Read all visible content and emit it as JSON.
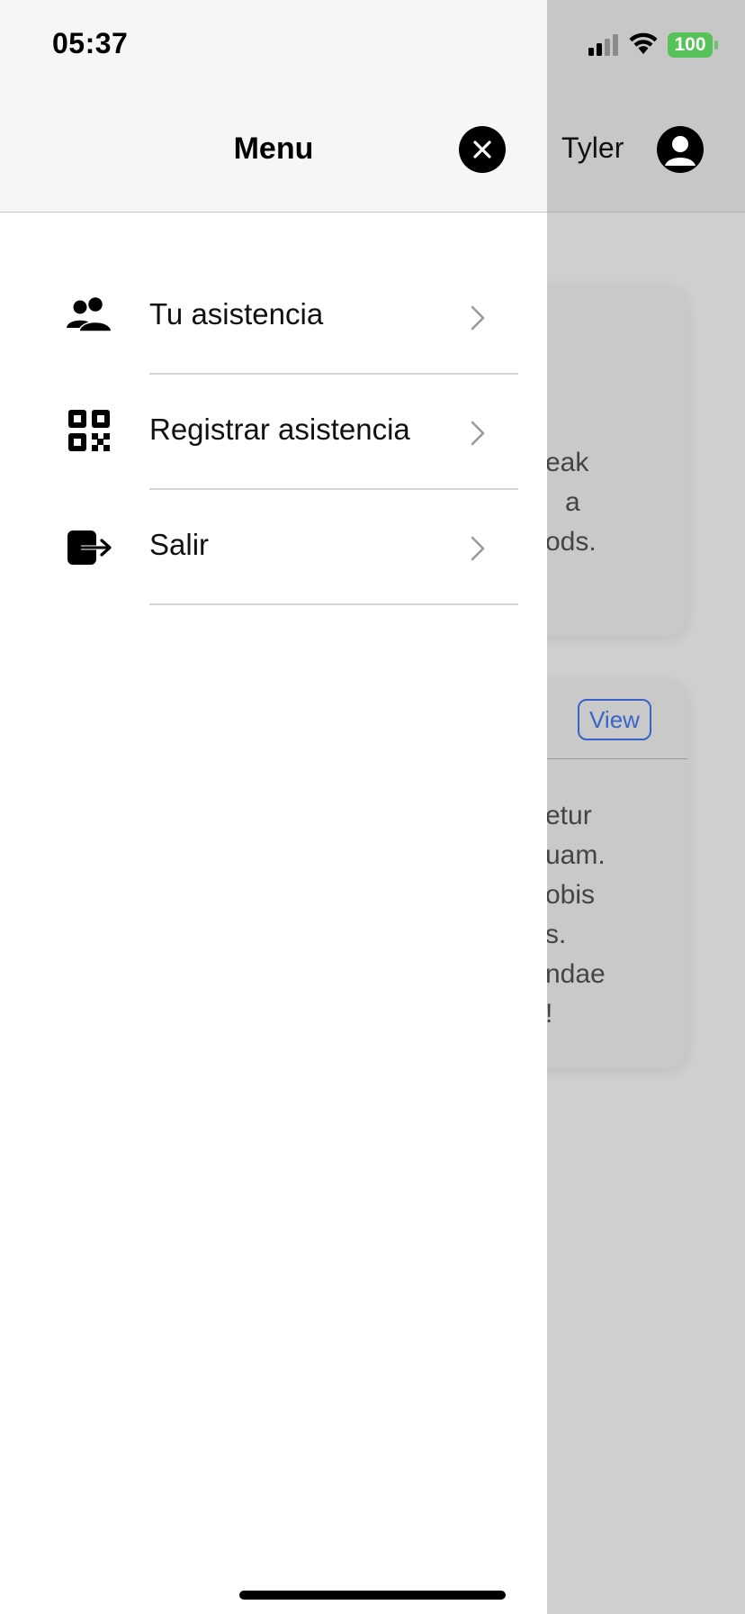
{
  "status_bar": {
    "time": "05:37",
    "battery": "100",
    "battery_color": "#58c25a"
  },
  "background_app": {
    "username": "Tyler",
    "card_one_lines": [
      "eak",
      "a",
      "ods."
    ],
    "card_two_view_button": "View",
    "card_two_lines": [
      "etur",
      "uam.",
      "obis",
      "s.",
      "ndae",
      "!"
    ]
  },
  "drawer": {
    "title": "Menu",
    "close_icon": "close-icon",
    "items": [
      {
        "label": "Tu asistencia",
        "icon": "people-icon"
      },
      {
        "label": "Registrar asistencia",
        "icon": "qr-code-icon"
      },
      {
        "label": "Salir",
        "icon": "logout-icon"
      }
    ]
  },
  "colors": {
    "drawer_bg": "#ffffff",
    "header_bg": "#f6f6f6",
    "overlay_bg": "#cfcfcf",
    "accent": "#3a63c9"
  }
}
